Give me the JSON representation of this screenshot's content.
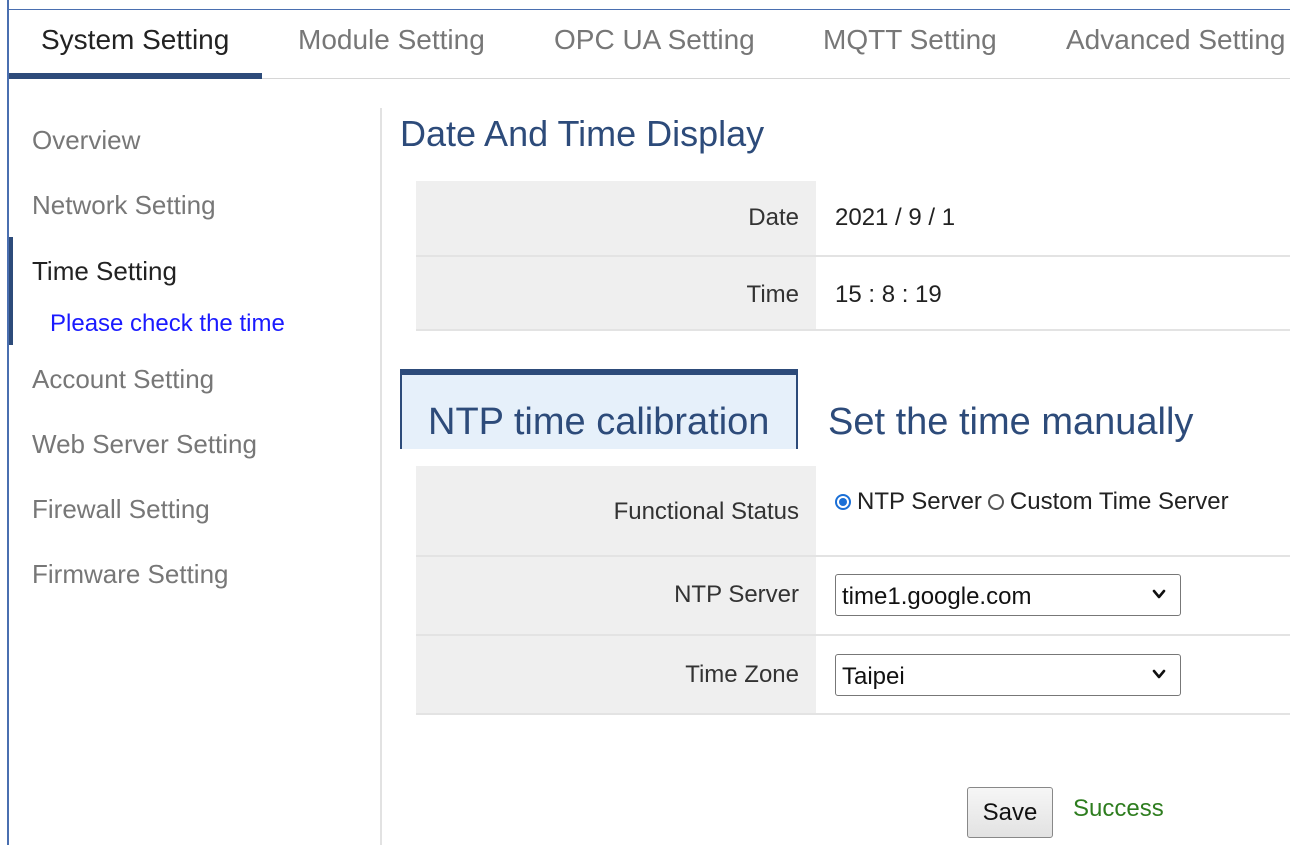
{
  "tabs": [
    {
      "label": "System Setting",
      "active": true
    },
    {
      "label": "Module Setting",
      "active": false
    },
    {
      "label": "OPC UA Setting",
      "active": false
    },
    {
      "label": "MQTT Setting",
      "active": false
    },
    {
      "label": "Advanced Setting",
      "active": false
    }
  ],
  "sidebar": {
    "items": [
      {
        "label": "Overview"
      },
      {
        "label": "Network Setting"
      },
      {
        "label": "Time Setting",
        "active": true
      },
      {
        "label": "Account Setting"
      },
      {
        "label": "Web Server Setting"
      },
      {
        "label": "Firewall Setting"
      },
      {
        "label": "Firmware Setting"
      }
    ],
    "sub_link": "Please check the time"
  },
  "main": {
    "title": "Date And Time Display",
    "display": {
      "date_label": "Date",
      "date_value": "2021 / 9 / 1",
      "time_label": "Time",
      "time_value": "15 : 8 : 19"
    },
    "subtabs": [
      {
        "label": "NTP time calibration",
        "active": true
      },
      {
        "label": "Set the time manually",
        "active": false
      }
    ],
    "form": {
      "functional_status_label": "Functional Status",
      "radio_ntp_label": "NTP Server",
      "radio_custom_label": "Custom Time Server",
      "selected_radio": "NTP Server",
      "ntp_server_label": "NTP Server",
      "ntp_server_value": "time1.google.com",
      "time_zone_label": "Time Zone",
      "time_zone_value": "Taipei"
    },
    "save_label": "Save",
    "status_text": "Success"
  },
  "colors": {
    "accent": "#2d4b7a",
    "link": "#1a1aff",
    "success": "#2e7d1f",
    "label_bg": "#efefef"
  }
}
